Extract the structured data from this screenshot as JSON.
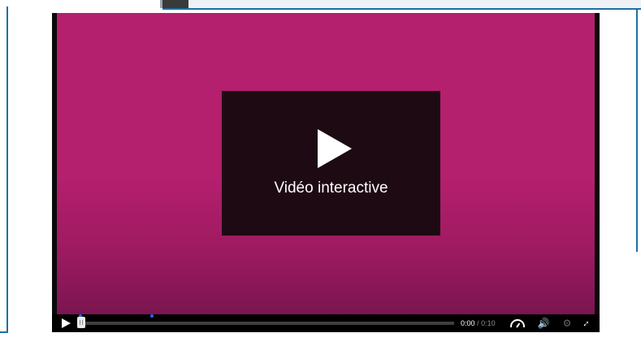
{
  "player": {
    "overlay_label": "Vidéo interactive",
    "current_time": "0:00",
    "separator": "/",
    "total_time": "0:10"
  },
  "icons": {
    "play": "play-icon",
    "big_play": "big-play-icon",
    "playback_rate": "speed-gauge-icon",
    "volume": "volume-icon",
    "settings": "gear-icon",
    "fullscreen": "fullscreen-icon"
  },
  "progress": 0.0,
  "colors": {
    "video_background": "#b41f6e",
    "overlay": "#1e0a12",
    "interaction_marker": "#1a6cff"
  }
}
